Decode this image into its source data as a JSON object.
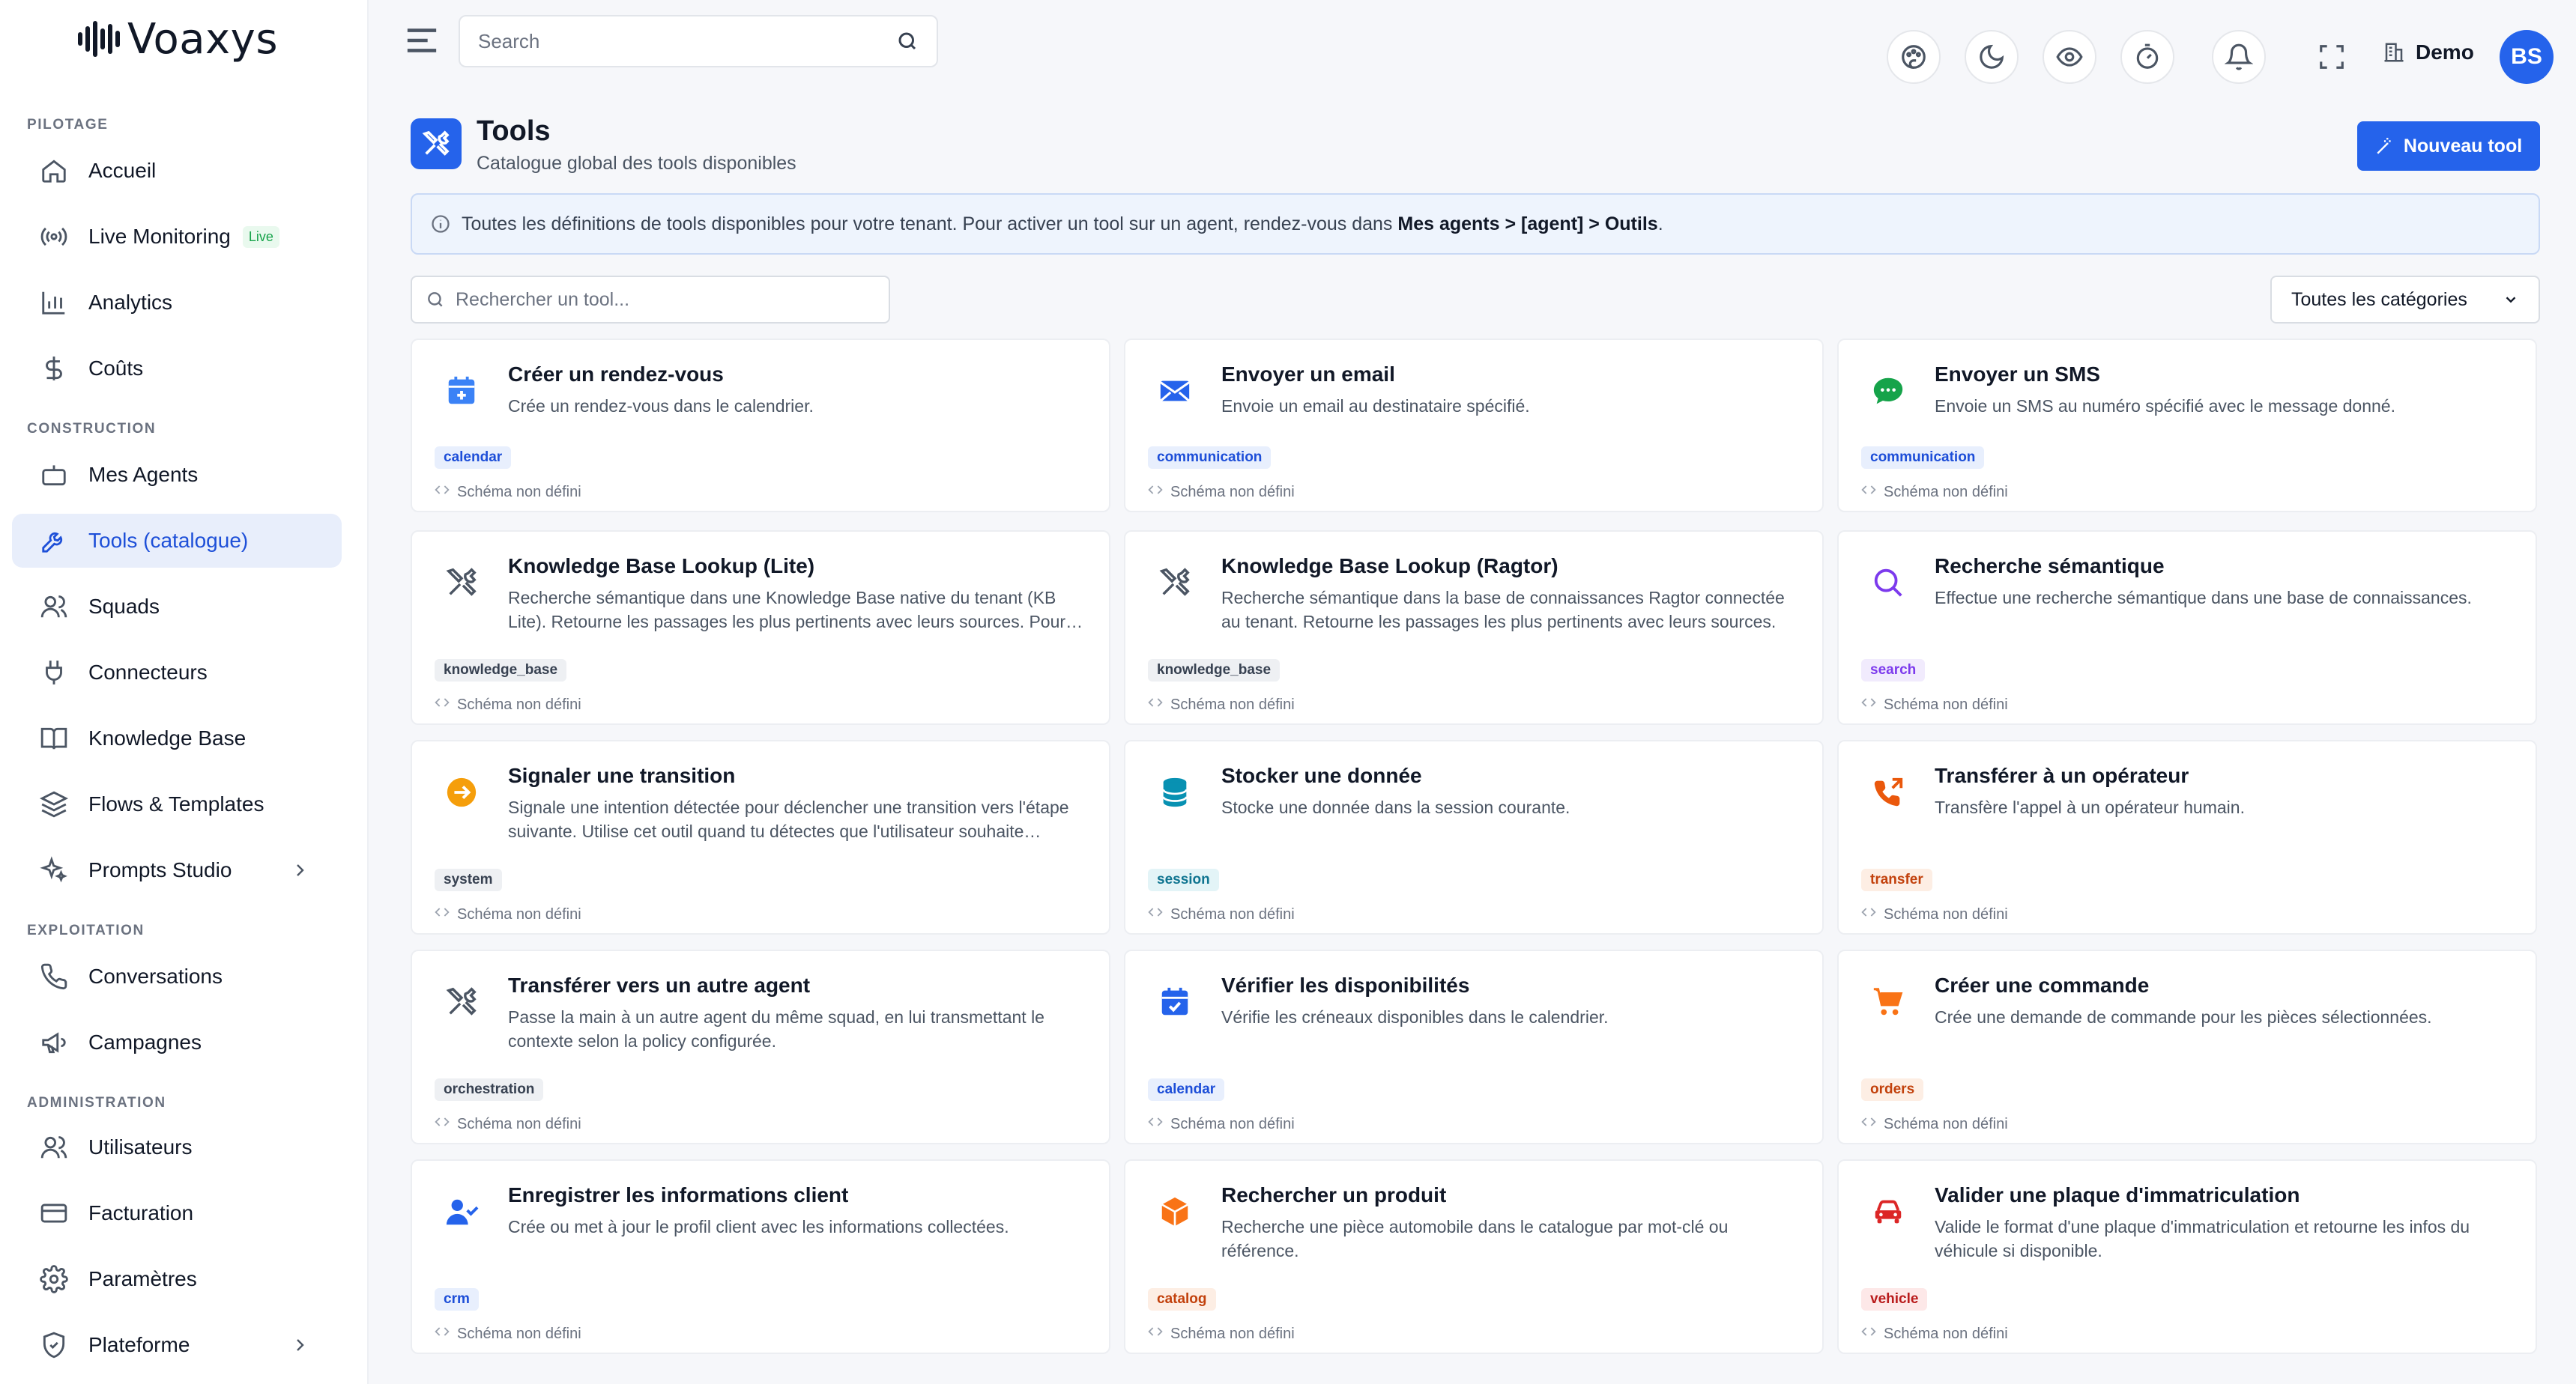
{
  "brand": {
    "name": "Voaxys"
  },
  "sidebar": {
    "sections": [
      {
        "title": "PILOTAGE"
      },
      {
        "title": "CONSTRUCTION"
      },
      {
        "title": "EXPLOITATION"
      },
      {
        "title": "ADMINISTRATION"
      }
    ],
    "items": [
      {
        "label": "Accueil",
        "icon": "home-icon"
      },
      {
        "label": "Live Monitoring",
        "icon": "broadcast-icon",
        "badge": "Live"
      },
      {
        "label": "Analytics",
        "icon": "bar-chart-icon"
      },
      {
        "label": "Coûts",
        "icon": "dollar-icon"
      },
      {
        "label": "Mes Agents",
        "icon": "bot-icon"
      },
      {
        "label": "Tools (catalogue)",
        "icon": "wrench-icon"
      },
      {
        "label": "Squads",
        "icon": "users-icon"
      },
      {
        "label": "Connecteurs",
        "icon": "plug-icon"
      },
      {
        "label": "Knowledge Base",
        "icon": "book-icon"
      },
      {
        "label": "Flows & Templates",
        "icon": "layers-icon"
      },
      {
        "label": "Prompts Studio",
        "icon": "sparkles-icon"
      },
      {
        "label": "Conversations",
        "icon": "phone-icon"
      },
      {
        "label": "Campagnes",
        "icon": "megaphone-icon"
      },
      {
        "label": "Utilisateurs",
        "icon": "users-icon"
      },
      {
        "label": "Facturation",
        "icon": "credit-card-icon"
      },
      {
        "label": "Paramètres",
        "icon": "gear-icon"
      },
      {
        "label": "Plateforme",
        "icon": "shield-icon"
      }
    ]
  },
  "topbar": {
    "search_placeholder": "Search",
    "tenant": "Demo",
    "avatar_initials": "BS"
  },
  "header": {
    "title": "Tools",
    "subtitle": "Catalogue global des tools disponibles",
    "new_button": "Nouveau tool"
  },
  "info": {
    "text": "Toutes les définitions de tools disponibles pour votre tenant. Pour activer un tool sur un agent, rendez-vous dans ",
    "path": "Mes agents > [agent] > Outils",
    "end": "."
  },
  "filters": {
    "search_placeholder": "Rechercher un tool...",
    "category_selected": "Toutes les catégories"
  },
  "schema_label": "Schéma non défini",
  "colors": {
    "accent": "#2563eb"
  },
  "tools": [
    {
      "title": "Créer un rendez-vous",
      "desc": "Crée un rendez-vous dans le calendrier.",
      "tag": "calendar",
      "icon": "calendar-plus-icon"
    },
    {
      "title": "Envoyer un email",
      "desc": "Envoie un email au destinataire spécifié.",
      "tag": "communication",
      "icon": "mail-icon"
    },
    {
      "title": "Envoyer un SMS",
      "desc": "Envoie un SMS au numéro spécifié avec le message donné.",
      "tag": "communication",
      "icon": "sms-icon"
    },
    {
      "title": "Knowledge Base Lookup (Lite)",
      "desc": "Recherche sémantique dans une Knowledge Base native du tenant (KB Lite). Retourne les passages les plus pertinents avec leurs sources. Pour les questions factuelles.",
      "tag": "knowledge_base",
      "icon": "tools-icon"
    },
    {
      "title": "Knowledge Base Lookup (Ragtor)",
      "desc": "Recherche sémantique dans la base de connaissances Ragtor connectée au tenant. Retourne les passages les plus pertinents avec leurs sources.",
      "tag": "knowledge_base",
      "icon": "tools-icon"
    },
    {
      "title": "Recherche sémantique",
      "desc": "Effectue une recherche sémantique dans une base de connaissances.",
      "tag": "search",
      "icon": "magnifier-icon"
    },
    {
      "title": "Signaler une transition",
      "desc": "Signale une intention détectée pour déclencher une transition vers l'étape suivante. Utilise cet outil quand tu détectes que l'utilisateur souhaite changer d'étape.",
      "tag": "system",
      "icon": "arrow-circle-icon"
    },
    {
      "title": "Stocker une donnée",
      "desc": "Stocke une donnée dans la session courante.",
      "tag": "session",
      "icon": "database-icon"
    },
    {
      "title": "Transférer à un opérateur",
      "desc": "Transfère l'appel à un opérateur humain.",
      "tag": "transfer",
      "icon": "phone-forward-icon"
    },
    {
      "title": "Transférer vers un autre agent",
      "desc": "Passe la main à un autre agent du même squad, en lui transmettant le contexte selon la policy configurée.",
      "tag": "orchestration",
      "icon": "tools-icon"
    },
    {
      "title": "Vérifier les disponibilités",
      "desc": "Vérifie les créneaux disponibles dans le calendrier.",
      "tag": "calendar",
      "icon": "calendar-check-icon"
    },
    {
      "title": "Créer une commande",
      "desc": "Crée une demande de commande pour les pièces sélectionnées.",
      "tag": "orders",
      "icon": "cart-icon"
    },
    {
      "title": "Enregistrer les informations client",
      "desc": "Crée ou met à jour le profil client avec les informations collectées.",
      "tag": "crm",
      "icon": "user-check-icon"
    },
    {
      "title": "Rechercher un produit",
      "desc": "Recherche une pièce automobile dans le catalogue par mot-clé ou référence.",
      "tag": "catalog",
      "icon": "box-icon"
    },
    {
      "title": "Valider une plaque d'immatriculation",
      "desc": "Valide le format d'une plaque d'immatriculation et retourne les infos du véhicule si disponible.",
      "tag": "vehicle",
      "icon": "car-icon"
    }
  ]
}
